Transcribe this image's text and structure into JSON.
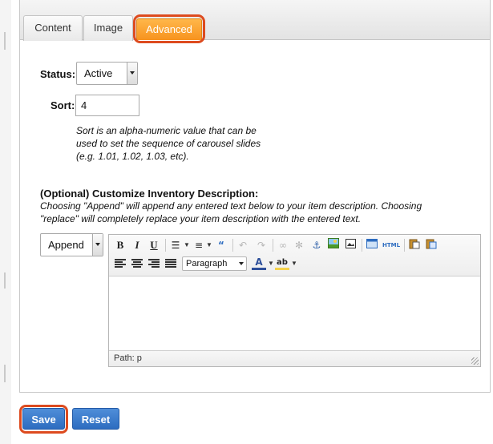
{
  "tabs": [
    {
      "label": "Content"
    },
    {
      "label": "Image"
    },
    {
      "label": "Advanced"
    }
  ],
  "status": {
    "label": "Status:",
    "selected": "Active"
  },
  "sort": {
    "label": "Sort:",
    "value": "4"
  },
  "sort_help": {
    "line1": "Sort is an alpha-numeric value that can be",
    "line2": "used to set the sequence of carousel slides",
    "line3": "(e.g. 1.01, 1.02, 1.03, etc)."
  },
  "inventory": {
    "heading": "(Optional) Customize Inventory Description:",
    "help_line1": "Choosing \"Append\" will append any entered text below to your item description. Choosing",
    "help_line2": "\"replace\" will completely replace your item description with the entered text.",
    "mode_selected": "Append"
  },
  "editor": {
    "toolbar": {
      "bold": "B",
      "italic": "I",
      "underline": "U",
      "html_label": "HTML",
      "format_selected": "Paragraph",
      "font_color_label": "A"
    },
    "status_path": "Path: p"
  },
  "buttons": {
    "save": "Save",
    "reset": "Reset"
  },
  "colors": {
    "active_tab": "#f7931e",
    "highlight": "#dd4b1f",
    "button_blue": "#2d6cc0"
  }
}
